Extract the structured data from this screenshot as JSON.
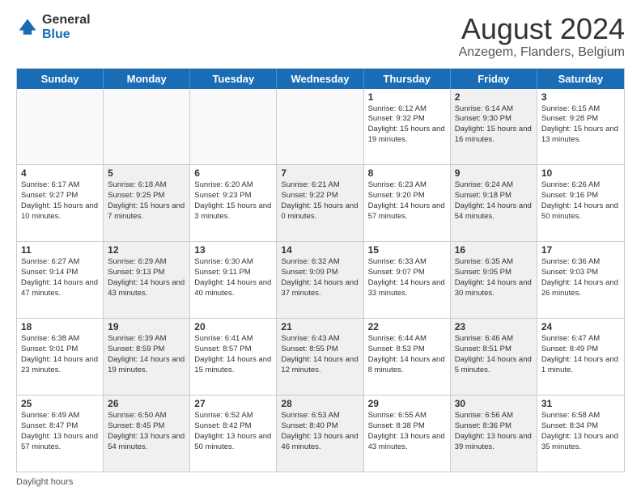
{
  "header": {
    "logo_general": "General",
    "logo_blue": "Blue",
    "title": "August 2024",
    "subtitle": "Anzegem, Flanders, Belgium"
  },
  "days_of_week": [
    "Sunday",
    "Monday",
    "Tuesday",
    "Wednesday",
    "Thursday",
    "Friday",
    "Saturday"
  ],
  "footer_text": "Daylight hours",
  "weeks": [
    [
      {
        "day": "",
        "empty": true,
        "shaded": false
      },
      {
        "day": "",
        "empty": true,
        "shaded": false
      },
      {
        "day": "",
        "empty": true,
        "shaded": false
      },
      {
        "day": "",
        "empty": true,
        "shaded": false
      },
      {
        "day": "1",
        "empty": false,
        "shaded": false,
        "sunrise": "6:12 AM",
        "sunset": "9:32 PM",
        "daylight": "15 hours and 19 minutes."
      },
      {
        "day": "2",
        "empty": false,
        "shaded": true,
        "sunrise": "6:14 AM",
        "sunset": "9:30 PM",
        "daylight": "15 hours and 16 minutes."
      },
      {
        "day": "3",
        "empty": false,
        "shaded": false,
        "sunrise": "6:15 AM",
        "sunset": "9:28 PM",
        "daylight": "15 hours and 13 minutes."
      }
    ],
    [
      {
        "day": "4",
        "empty": false,
        "shaded": false,
        "sunrise": "6:17 AM",
        "sunset": "9:27 PM",
        "daylight": "15 hours and 10 minutes."
      },
      {
        "day": "5",
        "empty": false,
        "shaded": true,
        "sunrise": "6:18 AM",
        "sunset": "9:25 PM",
        "daylight": "15 hours and 7 minutes."
      },
      {
        "day": "6",
        "empty": false,
        "shaded": false,
        "sunrise": "6:20 AM",
        "sunset": "9:23 PM",
        "daylight": "15 hours and 3 minutes."
      },
      {
        "day": "7",
        "empty": false,
        "shaded": true,
        "sunrise": "6:21 AM",
        "sunset": "9:22 PM",
        "daylight": "15 hours and 0 minutes."
      },
      {
        "day": "8",
        "empty": false,
        "shaded": false,
        "sunrise": "6:23 AM",
        "sunset": "9:20 PM",
        "daylight": "14 hours and 57 minutes."
      },
      {
        "day": "9",
        "empty": false,
        "shaded": true,
        "sunrise": "6:24 AM",
        "sunset": "9:18 PM",
        "daylight": "14 hours and 54 minutes."
      },
      {
        "day": "10",
        "empty": false,
        "shaded": false,
        "sunrise": "6:26 AM",
        "sunset": "9:16 PM",
        "daylight": "14 hours and 50 minutes."
      }
    ],
    [
      {
        "day": "11",
        "empty": false,
        "shaded": false,
        "sunrise": "6:27 AM",
        "sunset": "9:14 PM",
        "daylight": "14 hours and 47 minutes."
      },
      {
        "day": "12",
        "empty": false,
        "shaded": true,
        "sunrise": "6:29 AM",
        "sunset": "9:13 PM",
        "daylight": "14 hours and 43 minutes."
      },
      {
        "day": "13",
        "empty": false,
        "shaded": false,
        "sunrise": "6:30 AM",
        "sunset": "9:11 PM",
        "daylight": "14 hours and 40 minutes."
      },
      {
        "day": "14",
        "empty": false,
        "shaded": true,
        "sunrise": "6:32 AM",
        "sunset": "9:09 PM",
        "daylight": "14 hours and 37 minutes."
      },
      {
        "day": "15",
        "empty": false,
        "shaded": false,
        "sunrise": "6:33 AM",
        "sunset": "9:07 PM",
        "daylight": "14 hours and 33 minutes."
      },
      {
        "day": "16",
        "empty": false,
        "shaded": true,
        "sunrise": "6:35 AM",
        "sunset": "9:05 PM",
        "daylight": "14 hours and 30 minutes."
      },
      {
        "day": "17",
        "empty": false,
        "shaded": false,
        "sunrise": "6:36 AM",
        "sunset": "9:03 PM",
        "daylight": "14 hours and 26 minutes."
      }
    ],
    [
      {
        "day": "18",
        "empty": false,
        "shaded": false,
        "sunrise": "6:38 AM",
        "sunset": "9:01 PM",
        "daylight": "14 hours and 23 minutes."
      },
      {
        "day": "19",
        "empty": false,
        "shaded": true,
        "sunrise": "6:39 AM",
        "sunset": "8:59 PM",
        "daylight": "14 hours and 19 minutes."
      },
      {
        "day": "20",
        "empty": false,
        "shaded": false,
        "sunrise": "6:41 AM",
        "sunset": "8:57 PM",
        "daylight": "14 hours and 15 minutes."
      },
      {
        "day": "21",
        "empty": false,
        "shaded": true,
        "sunrise": "6:43 AM",
        "sunset": "8:55 PM",
        "daylight": "14 hours and 12 minutes."
      },
      {
        "day": "22",
        "empty": false,
        "shaded": false,
        "sunrise": "6:44 AM",
        "sunset": "8:53 PM",
        "daylight": "14 hours and 8 minutes."
      },
      {
        "day": "23",
        "empty": false,
        "shaded": true,
        "sunrise": "6:46 AM",
        "sunset": "8:51 PM",
        "daylight": "14 hours and 5 minutes."
      },
      {
        "day": "24",
        "empty": false,
        "shaded": false,
        "sunrise": "6:47 AM",
        "sunset": "8:49 PM",
        "daylight": "14 hours and 1 minute."
      }
    ],
    [
      {
        "day": "25",
        "empty": false,
        "shaded": false,
        "sunrise": "6:49 AM",
        "sunset": "8:47 PM",
        "daylight": "13 hours and 57 minutes."
      },
      {
        "day": "26",
        "empty": false,
        "shaded": true,
        "sunrise": "6:50 AM",
        "sunset": "8:45 PM",
        "daylight": "13 hours and 54 minutes."
      },
      {
        "day": "27",
        "empty": false,
        "shaded": false,
        "sunrise": "6:52 AM",
        "sunset": "8:42 PM",
        "daylight": "13 hours and 50 minutes."
      },
      {
        "day": "28",
        "empty": false,
        "shaded": true,
        "sunrise": "6:53 AM",
        "sunset": "8:40 PM",
        "daylight": "13 hours and 46 minutes."
      },
      {
        "day": "29",
        "empty": false,
        "shaded": false,
        "sunrise": "6:55 AM",
        "sunset": "8:38 PM",
        "daylight": "13 hours and 43 minutes."
      },
      {
        "day": "30",
        "empty": false,
        "shaded": true,
        "sunrise": "6:56 AM",
        "sunset": "8:36 PM",
        "daylight": "13 hours and 39 minutes."
      },
      {
        "day": "31",
        "empty": false,
        "shaded": false,
        "sunrise": "6:58 AM",
        "sunset": "8:34 PM",
        "daylight": "13 hours and 35 minutes."
      }
    ]
  ]
}
